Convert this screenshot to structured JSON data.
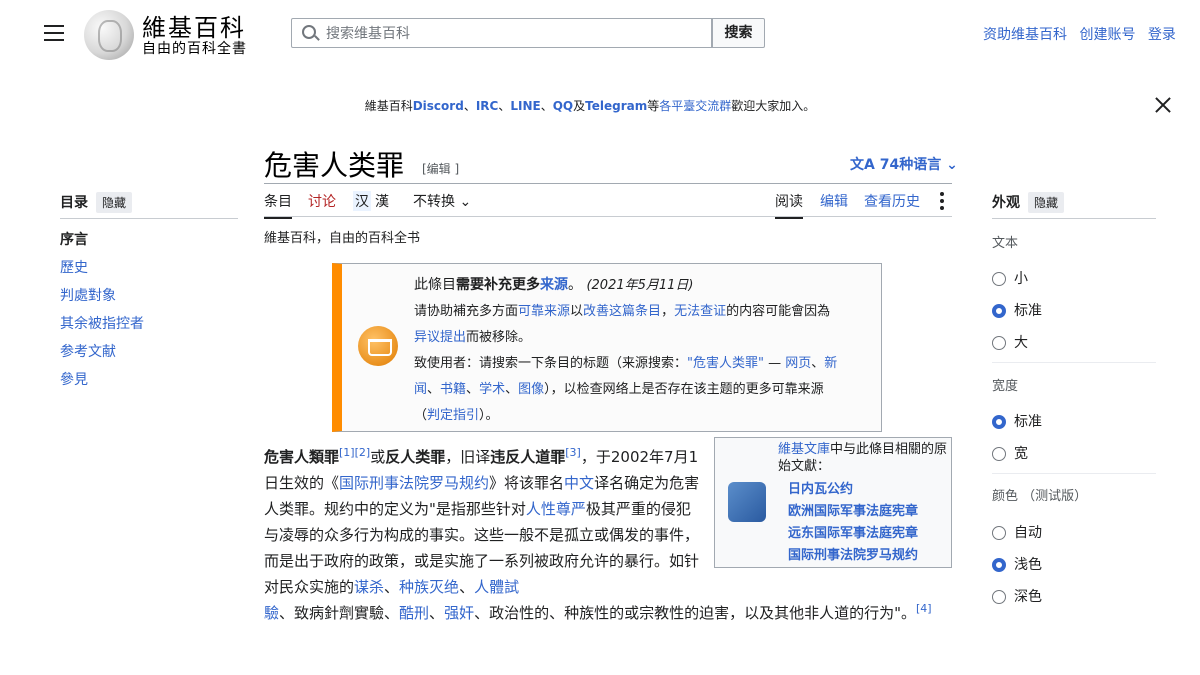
{
  "header": {
    "logo_title": "維基百科",
    "logo_tagline": "自由的百科全書",
    "search_placeholder": "搜索维基百科",
    "search_button": "搜索",
    "user_links": [
      "资助维基百科",
      "创建账号",
      "登录"
    ]
  },
  "sitenotice": {
    "prefix": "維基百科",
    "discord": "Discord",
    "sep1": "、",
    "irc": "IRC",
    "sep2": "、",
    "line": "LINE",
    "sep3": "、",
    "qq": "QQ",
    "ji": "及",
    "telegram": "Telegram",
    "deng": "等",
    "groups_link": "各平臺交流群",
    "suffix": "歡迎大家加入。"
  },
  "toc": {
    "title": "目录",
    "hide": "隐藏",
    "items": [
      "序言",
      "歷史",
      "判處對象",
      "其余被指控者",
      "参考文献",
      "參見"
    ]
  },
  "article": {
    "title": "危害人类罪",
    "edit_link": "[编辑 ]",
    "languages": "74种语言",
    "tabs": {
      "article": "条目",
      "talk": "讨论",
      "variant_hans": "汉",
      "variant_hant": "漢",
      "convert": "不转换",
      "read": "阅读",
      "edit": "编辑",
      "history": "查看历史"
    },
    "tagline": "維基百科，自由的百科全书"
  },
  "ambox": {
    "title_a": "此條目",
    "title_b": "需要补充更多",
    "title_c": "来源",
    "title_d": "。",
    "date": "(2021年5月11日)",
    "line2_a": "请协助補充多方面",
    "line2_b": "可靠来源",
    "line2_c": "以",
    "line2_d": "改善这篇条目",
    "line2_e": "，",
    "line2_f": "无法查证",
    "line2_g": "的内容可能會因為",
    "line3_a": "异议提出",
    "line3_b": "而被移除。",
    "line4_a": "致使用者：请搜索一下条目的标题（来源搜索：",
    "line4_b": "\"危害人类罪\"",
    "line4_c": " — ",
    "line4_d": "网页",
    "line4_e": "、",
    "line4_f": "新",
    "line5_a": "闻",
    "line5_b": "、",
    "line5_c": "书籍",
    "line5_d": "、",
    "line5_e": "学术",
    "line5_f": "、",
    "line5_g": "图像",
    "line5_h": "），以检查网络上是否存在该主题的更多可靠来源",
    "line6_a": "（",
    "line6_b": "判定指引",
    "line6_c": "）。"
  },
  "wikisource": {
    "intro_link": "維基文庫",
    "intro_text": "中与此條目相關的原始文獻：",
    "links": [
      "日内瓦公约",
      "欧洲国际军事法庭宪章",
      "远东国际军事法庭宪章",
      "国际刑事法院罗马规约"
    ]
  },
  "body": {
    "p1_b1": "危害人類罪",
    "ref1": "[1]",
    "ref2": "[2]",
    "p1_t1": "或",
    "p1_b2": "反人类罪",
    "p1_t2": "，旧译",
    "p1_b3": "违反人道罪",
    "ref3": "[3]",
    "p1_t3": "，于2002年7月1日生效的《",
    "p1_l1": "国际刑事法院罗马规约",
    "p1_t4": "》将该罪名",
    "p1_l2": "中文",
    "p1_t5": "译名确定为危害人类罪。规约中的定义为\"是指那些针对",
    "p1_l3": "人性尊严",
    "p1_t6": "极其严重的侵犯与凌辱的众多行为构成的事实。这些一般不是孤立或偶发的事件，而是出于政府的政策，或是实施了一系列被政府允许的暴行。如针对民众实施的",
    "p1_l4": "谋杀",
    "p1_t7": "、",
    "p1_l5": "种族灭绝",
    "p1_t8": "、",
    "p1_l6": "人體試",
    "p2_l6b": "驗",
    "p2_t1": "、致病針劑實驗、",
    "p2_l7": "酷刑",
    "p2_t2": "、",
    "p2_l8": "强奸",
    "p2_t3": "、政治性的、种族性的或宗教性的迫害，以及其他非人道的行为\"。",
    "ref4": "[4]"
  },
  "appearance": {
    "title": "外观",
    "hide": "隐藏",
    "text_group": "文本",
    "text_options": [
      "小",
      "标准",
      "大"
    ],
    "text_selected": "标准",
    "width_group": "宽度",
    "width_options": [
      "标准",
      "宽"
    ],
    "width_selected": "标准",
    "color_group": "颜色 （测试版）",
    "color_options": [
      "自动",
      "浅色",
      "深色"
    ],
    "color_selected": "浅色"
  },
  "colors": {
    "link": "#3366cc",
    "ambox_border": "#ff8c00",
    "radio_selected": "#3366cc"
  }
}
